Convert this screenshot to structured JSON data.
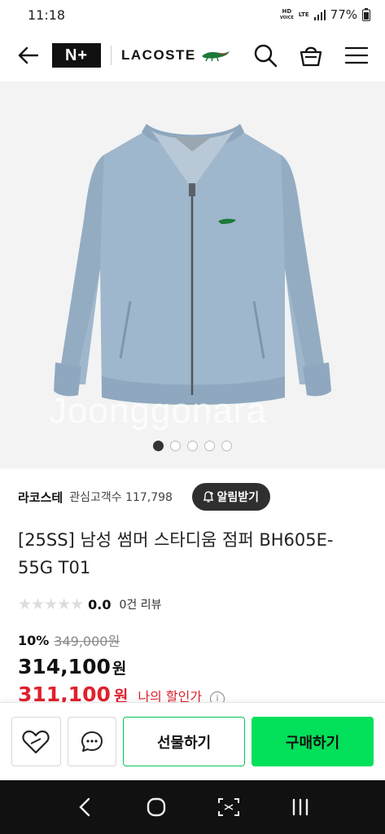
{
  "status_bar": {
    "time": "11:18",
    "hd_label": "HD",
    "voice_label": "VOICE",
    "lte_label": "LTE",
    "battery": "77%"
  },
  "header": {
    "nplus_label": "N+",
    "brand": "LACOSTE",
    "icons": [
      "back-arrow-icon",
      "search-icon",
      "shopping-bag-icon",
      "menu-icon"
    ]
  },
  "gallery": {
    "watermark": "Joonggonara",
    "page_count": 5,
    "active_page": 1
  },
  "seller": {
    "name": "라코스테",
    "interest_label": "관심고객수",
    "interest_count": "117,798",
    "alarm_button": "알림받기"
  },
  "product": {
    "title": "[25SS] 남성 썸머 스타디움 점퍼 BH605E-55G T01",
    "rating": "0.0",
    "rating_stars": 0,
    "review_count": "0건 리뷰",
    "discount_percent": "10%",
    "original_price": "349,000원",
    "price": "314,100",
    "price_unit": "원",
    "my_price": "311,100",
    "my_price_unit": "원",
    "my_price_label": "나의 할인가"
  },
  "actions": {
    "gift_label": "선물하기",
    "buy_label": "구매하기"
  },
  "colors": {
    "accent_green": "#03e05a",
    "gift_border": "#03c75a",
    "discount_red": "#e0212d",
    "jacket": "#9fb7cc"
  }
}
